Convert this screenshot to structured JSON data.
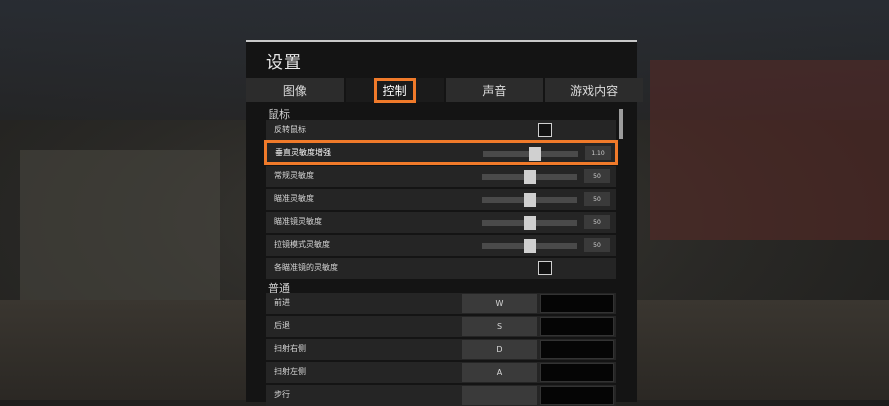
{
  "settings": {
    "title": "设置",
    "tabs": [
      {
        "label": "图像",
        "active": false
      },
      {
        "label": "控制",
        "active": true
      },
      {
        "label": "声音",
        "active": false
      },
      {
        "label": "游戏内容",
        "active": false
      }
    ],
    "mouse_section": {
      "title": "鼠标",
      "invert_label": "反转鼠标",
      "vertical_sensitivity": {
        "label": "垂直灵敏度增强",
        "value": "1.10",
        "level": 0.55
      },
      "general_sensitivity": {
        "label": "常规灵敏度",
        "value": "50",
        "level": 0.5
      },
      "aim_sensitivity": {
        "label": "瞄准灵敏度",
        "value": "50",
        "level": 0.5
      },
      "scope_sensitivity": {
        "label": "瞄准镜灵敏度",
        "value": "50",
        "level": 0.5
      },
      "zoom_sensitivity": {
        "label": "拉镜模式灵敏度",
        "value": "50",
        "level": 0.5
      },
      "per_scope_label": "各瞄准镜的灵敏度"
    },
    "common_section": {
      "title": "普通",
      "bindings": [
        {
          "label": "前进",
          "key": "W"
        },
        {
          "label": "后退",
          "key": "S"
        },
        {
          "label": "扫射右侧",
          "key": "D"
        },
        {
          "label": "扫射左侧",
          "key": "A"
        },
        {
          "label": "步行",
          "key": ""
        }
      ]
    },
    "accent_color": "#f07a2a"
  }
}
